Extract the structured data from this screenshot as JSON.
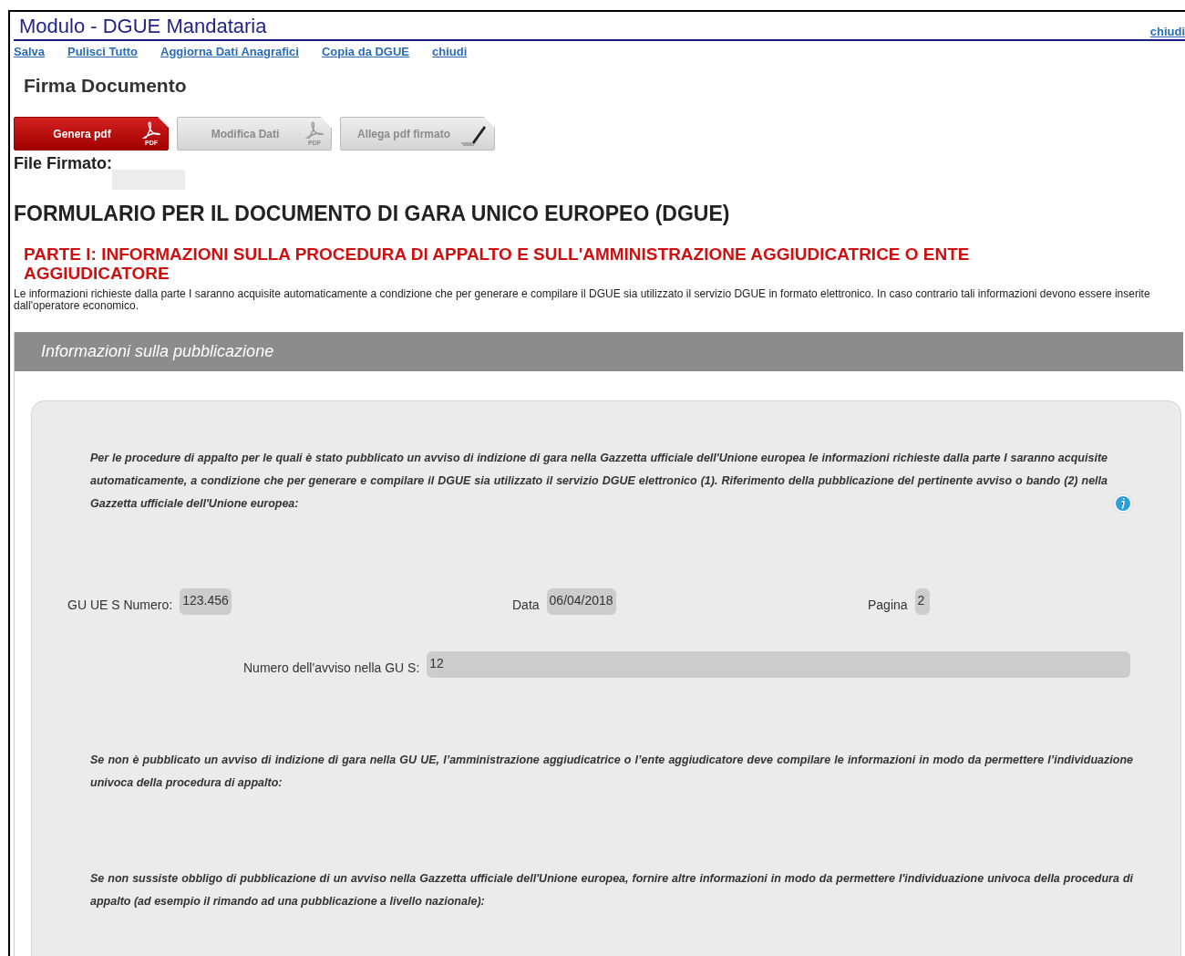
{
  "header": {
    "title": "Modulo - DGUE Mandataria",
    "close_link": "chiudi"
  },
  "toolbar_links": [
    "Salva",
    "Pulisci Tutto",
    "Aggiorna Dati Anagrafici",
    "Copia da DGUE",
    "chiudi"
  ],
  "sign_section": {
    "title": "Firma Documento",
    "buttons": [
      {
        "label": "Genera pdf",
        "kind": "pdf",
        "disabled": false,
        "icon_caption": "PDF"
      },
      {
        "label": "Modifica Dati",
        "kind": "pdf",
        "disabled": true,
        "icon_caption": "PDF"
      },
      {
        "label": "Allega pdf firmato",
        "kind": "pen",
        "disabled": true
      }
    ],
    "signed_file_label": "File Firmato:"
  },
  "form": {
    "title": "FORMULARIO PER IL DOCUMENTO DI GARA UNICO EUROPEO (DGUE)",
    "part_title": "PARTE I: INFORMAZIONI SULLA PROCEDURA DI APPALTO E SULL'AMMINISTRAZIONE AGGIUDICATRICE O ENTE AGGIUDICATORE",
    "intro": "Le informazioni richieste dalla parte I saranno acquisite automaticamente a condizione che per generare e compilare il DGUE sia utilizzato il servizio DGUE in formato elettronico. In caso contrario tali informazioni devono essere inserite dall'operatore economico.",
    "panel": {
      "title": "Informazioni sulla pubblicazione",
      "note": "Per le procedure di appalto per le quali è stato pubblicato un avviso di indizione di gara nella Gazzetta ufficiale dell'Unione europea le informazioni richieste dalla parte I saranno acquisite automaticamente, a condizione che per generare e compilare il DGUE sia utilizzato il servizio DGUE elettronico (1). Riferimento della pubblicazione del pertinente avviso o bando (2) nella Gazzetta ufficiale dell'Unione europea:",
      "fields_row": [
        {
          "label": "GU UE S Numero:",
          "value": "123.456"
        },
        {
          "label": "Data",
          "value": "06/04/2018"
        },
        {
          "label": "Pagina",
          "value": "2"
        }
      ],
      "notice_field": {
        "label": "Numero dell'avviso nella GU S:",
        "value": "12"
      },
      "paragraphs": [
        "Se non è pubblicato un avviso di indizione di gara nella GU UE, l’amministrazione aggiudicatrice o l’ente aggiudicatore deve compilare le informazioni in modo da permettere l’individuazione univoca della procedura di appalto:",
        "Se non sussiste obbligo di pubblicazione di un avviso nella Gazzetta ufficiale dell'Unione europea, fornire altre informazioni in modo da permettere l'individuazione univoca della procedura di appalto (ad esempio il rimando ad una pubblicazione a livello nazionale):"
      ]
    }
  }
}
